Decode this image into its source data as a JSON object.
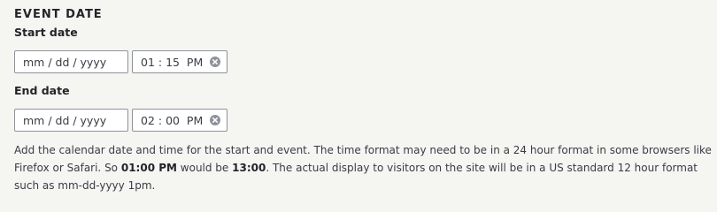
{
  "section": {
    "title": "EVENT DATE"
  },
  "start": {
    "label": "Start date",
    "date_placeholder": "mm / dd / yyyy",
    "time_value": "01 : 15  PM"
  },
  "end": {
    "label": "End date",
    "date_placeholder": "mm / dd / yyyy",
    "time_value": "02 : 00  PM"
  },
  "help": {
    "part1": "Add the calendar date and time for the start and event. The time format may need to be in a 24 hour format in some browsers like Firefox or Safari. So ",
    "bold1": "01:00 PM",
    "part2": " would be ",
    "bold2": "13:00",
    "part3": ". The actual display to visitors on the site will be in a US standard 12 hour format such as mm-dd-yyyy 1pm."
  },
  "icons": {
    "clear": "clear-circle-x-icon"
  },
  "colors": {
    "border": "#8e929c",
    "background": "#f5f5f2",
    "text": "#232429",
    "icon": "#8e929c"
  }
}
